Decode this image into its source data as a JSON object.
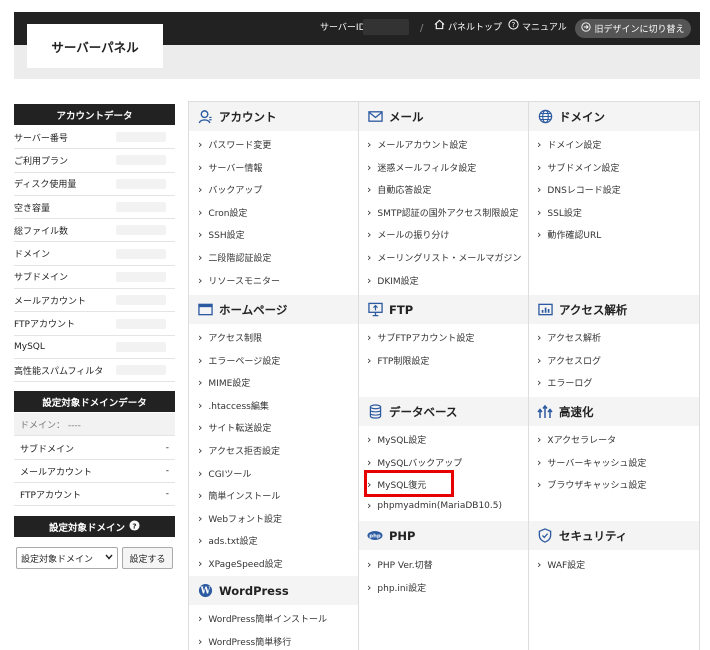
{
  "header": {
    "logo": "サーバーパネル",
    "server_id_label": "サーバーID",
    "panel_top": "パネルトップ",
    "manual": "マニュアル",
    "old_design": "旧デザインに切り替え"
  },
  "sidebar": {
    "account_data_title": "アカウントデータ",
    "account_rows": [
      "サーバー番号",
      "ご利用プラン",
      "ディスク使用量",
      "空き容量",
      "総ファイル数",
      "ドメイン",
      "サブドメイン",
      "メールアカウント",
      "FTPアカウント",
      "MySQL",
      "高性能スパムフィルタ"
    ],
    "target_domain_data_title": "設定対象ドメインデータ",
    "domain_label": "ドメイン： ----",
    "domain_rows": [
      {
        "label": "サブドメイン",
        "value": "-"
      },
      {
        "label": "メールアカウント",
        "value": "-"
      },
      {
        "label": "FTPアカウント",
        "value": "-"
      }
    ],
    "target_domain_title": "設定対象ドメイン",
    "select_value": "設定対象ドメイン",
    "set_button": "設定する"
  },
  "sections": {
    "account": {
      "title": "アカウント",
      "links": [
        "パスワード変更",
        "サーバー情報",
        "バックアップ",
        "Cron設定",
        "SSH設定",
        "二段階認証設定",
        "リソースモニター"
      ]
    },
    "mail": {
      "title": "メール",
      "links": [
        "メールアカウント設定",
        "迷惑メールフィルタ設定",
        "自動応答設定",
        "SMTP認証の国外アクセス制限設定",
        "メールの振り分け",
        "メーリングリスト・メールマガジン",
        "DKIM設定"
      ]
    },
    "domain": {
      "title": "ドメイン",
      "links": [
        "ドメイン設定",
        "サブドメイン設定",
        "DNSレコード設定",
        "SSL設定",
        "動作確認URL"
      ]
    },
    "homepage": {
      "title": "ホームページ",
      "links": [
        "アクセス制限",
        "エラーページ設定",
        "MIME設定",
        ".htaccess編集",
        "サイト転送設定",
        "アクセス拒否設定",
        "CGIツール",
        "簡単インストール",
        "Webフォント設定",
        "ads.txt設定",
        "XPageSpeed設定"
      ]
    },
    "ftp": {
      "title": "FTP",
      "links": [
        "サブFTPアカウント設定",
        "FTP制限設定"
      ]
    },
    "access": {
      "title": "アクセス解析",
      "links": [
        "アクセス解析",
        "アクセスログ",
        "エラーログ"
      ]
    },
    "database": {
      "title": "データベース",
      "links": [
        "MySQL設定",
        "MySQLバックアップ",
        "MySQL復元",
        "phpmyadmin(MariaDB10.5)"
      ]
    },
    "speed": {
      "title": "高速化",
      "links": [
        "Xアクセラレータ",
        "サーバーキャッシュ設定",
        "ブラウザキャッシュ設定"
      ]
    },
    "php": {
      "title": "PHP",
      "links": [
        "PHP Ver.切替",
        "php.ini設定"
      ]
    },
    "security": {
      "title": "セキュリティ",
      "links": [
        "WAF設定"
      ]
    },
    "wordpress": {
      "title": "WordPress",
      "links": [
        "WordPress簡単インストール",
        "WordPress簡単移行"
      ]
    }
  },
  "colors": {
    "accent": "#2c5aa0",
    "highlight": "#e60000",
    "topbar": "#222222"
  }
}
